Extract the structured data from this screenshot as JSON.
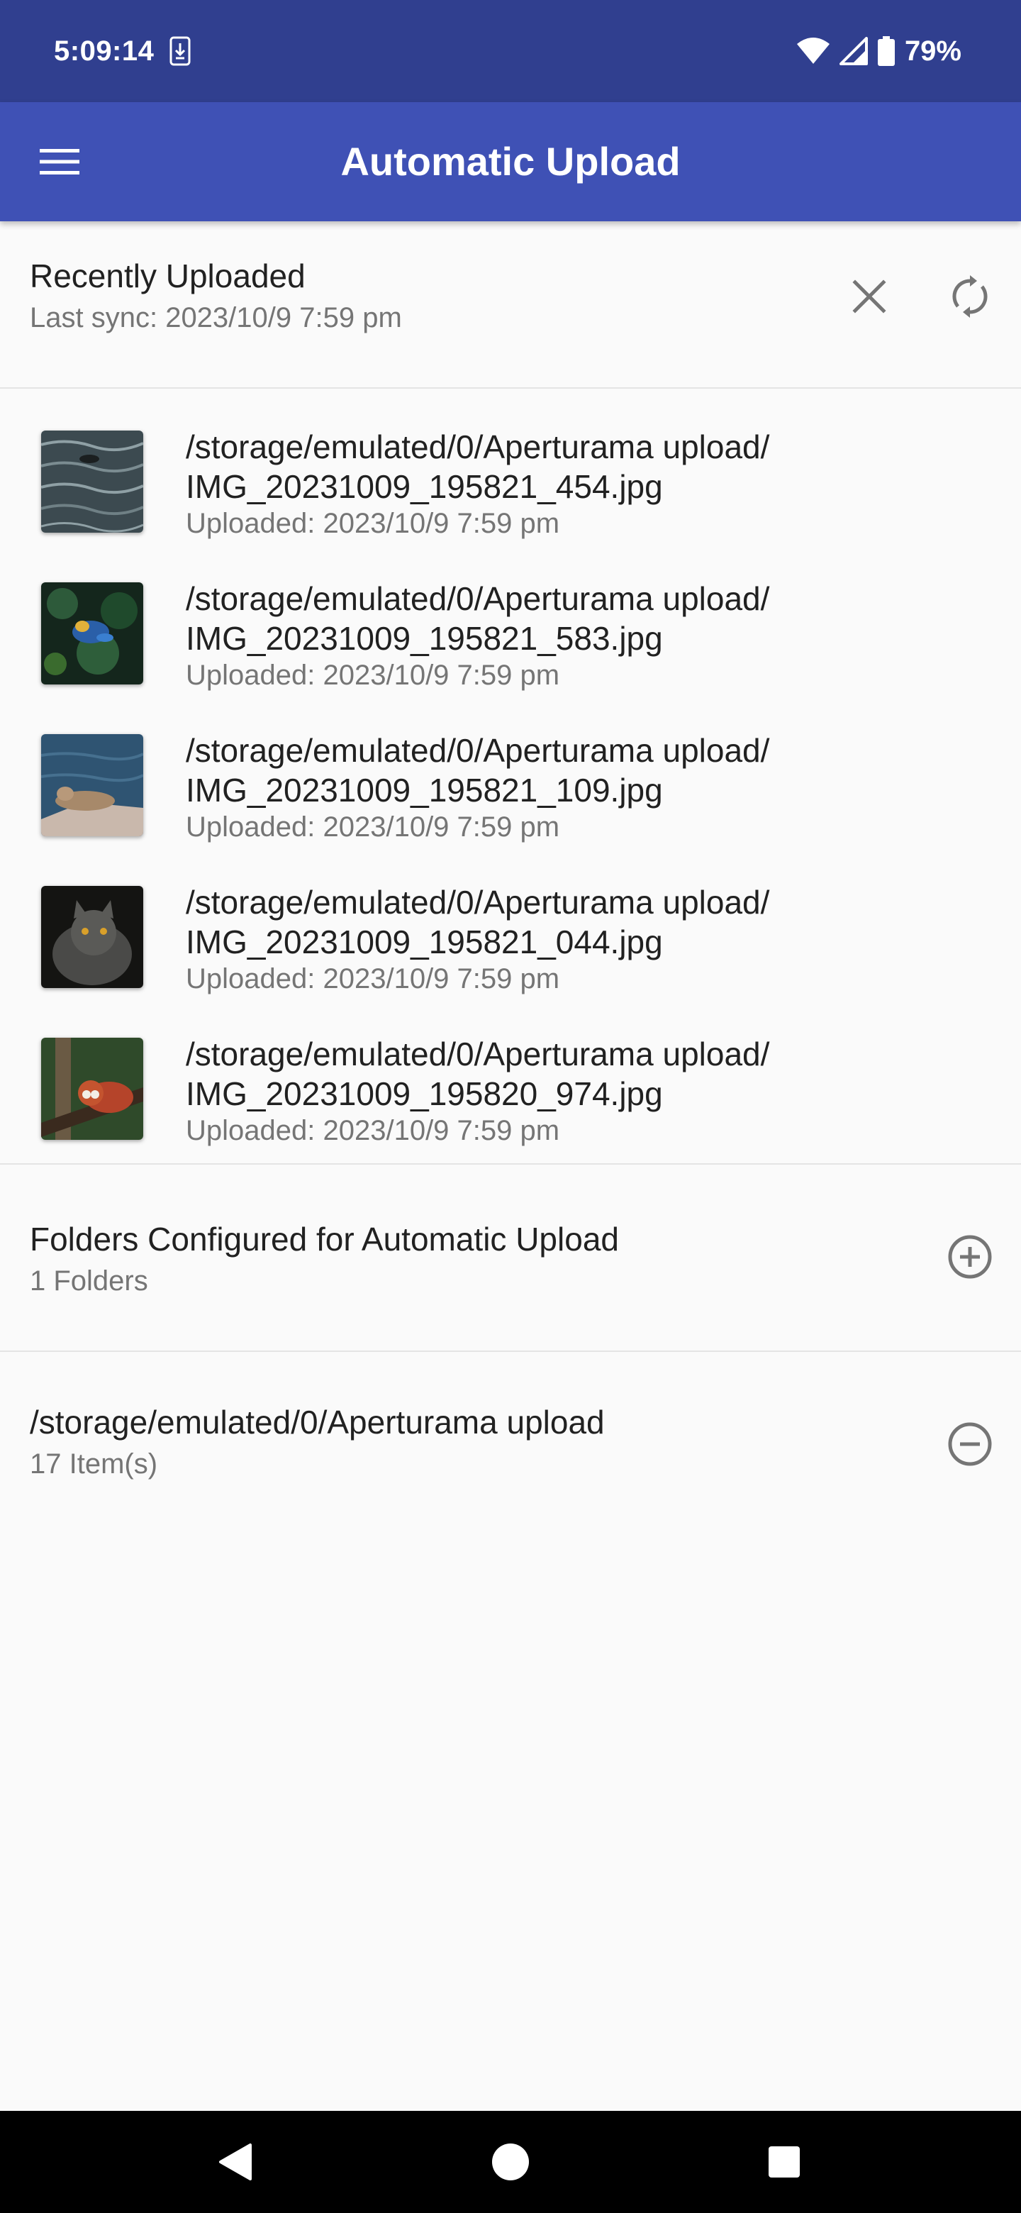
{
  "status_bar": {
    "time": "5:09:14",
    "battery_percent": "79%",
    "icons": [
      "download-notification-icon",
      "wifi-icon",
      "cell-signal-icon",
      "battery-icon"
    ]
  },
  "app_bar": {
    "title": "Automatic Upload",
    "menu_icon": "hamburger-menu-icon",
    "color": "#3f51b5",
    "status_color": "#303f8f"
  },
  "recent": {
    "title": "Recently Uploaded",
    "last_sync": "Last sync: 2023/10/9 7:59 pm",
    "clear_icon": "close-icon",
    "sync_icon": "sync-icon"
  },
  "uploads": [
    {
      "path_line1": "/storage/emulated/0/Aperturama upload/",
      "path_line2": "IMG_20231009_195821_454.jpg",
      "uploaded": "Uploaded: 2023/10/9 7:59 pm",
      "thumbnail": "duck-on-water"
    },
    {
      "path_line1": "/storage/emulated/0/Aperturama upload/",
      "path_line2": "IMG_20231009_195821_583.jpg",
      "uploaded": "Uploaded: 2023/10/9 7:59 pm",
      "thumbnail": "colorful-bird-foliage"
    },
    {
      "path_line1": "/storage/emulated/0/Aperturama upload/",
      "path_line2": "IMG_20231009_195821_109.jpg",
      "uploaded": "Uploaded: 2023/10/9 7:59 pm",
      "thumbnail": "sea-lion-on-rock"
    },
    {
      "path_line1": "/storage/emulated/0/Aperturama upload/",
      "path_line2": "IMG_20231009_195821_044.jpg",
      "uploaded": "Uploaded: 2023/10/9 7:59 pm",
      "thumbnail": "grey-cat"
    },
    {
      "path_line1": "/storage/emulated/0/Aperturama upload/",
      "path_line2": "IMG_20231009_195820_974.jpg",
      "uploaded": "Uploaded: 2023/10/9 7:59 pm",
      "thumbnail": "red-panda-on-branch"
    }
  ],
  "folders": {
    "title": "Folders Configured for Automatic Upload",
    "count": "1 Folders",
    "add_icon": "add-circle-icon",
    "items": [
      {
        "path": "/storage/emulated/0/Aperturama upload",
        "count": "17 Item(s)",
        "remove_icon": "remove-circle-icon"
      }
    ]
  },
  "nav_bar": {
    "icons": [
      "back-icon",
      "home-icon",
      "recents-icon"
    ]
  }
}
